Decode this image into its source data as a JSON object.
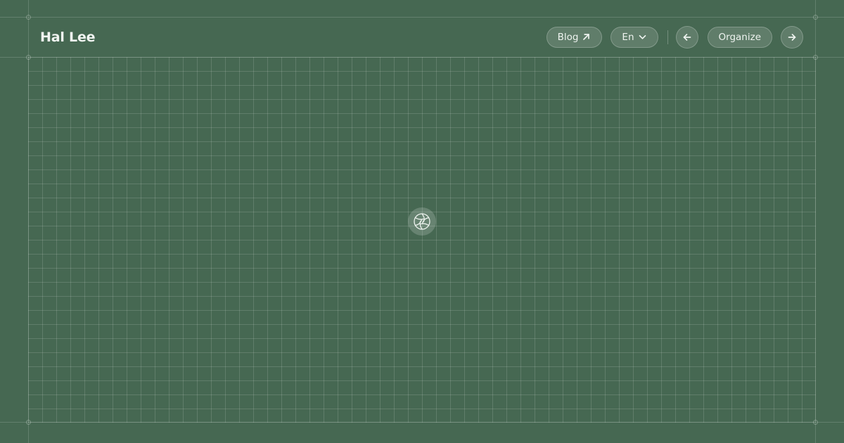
{
  "header": {
    "title": "Hal Lee"
  },
  "nav": {
    "blog_label": "Blog",
    "language_label": "En",
    "organize_label": "Organize"
  },
  "icons": {
    "blog": "arrow-up-right-icon",
    "language": "chevron-down-icon",
    "prev": "arrow-left-icon",
    "next": "arrow-right-icon",
    "center": "aperture-icon"
  },
  "colors": {
    "background": "#466852",
    "text": "#eef3ef"
  }
}
